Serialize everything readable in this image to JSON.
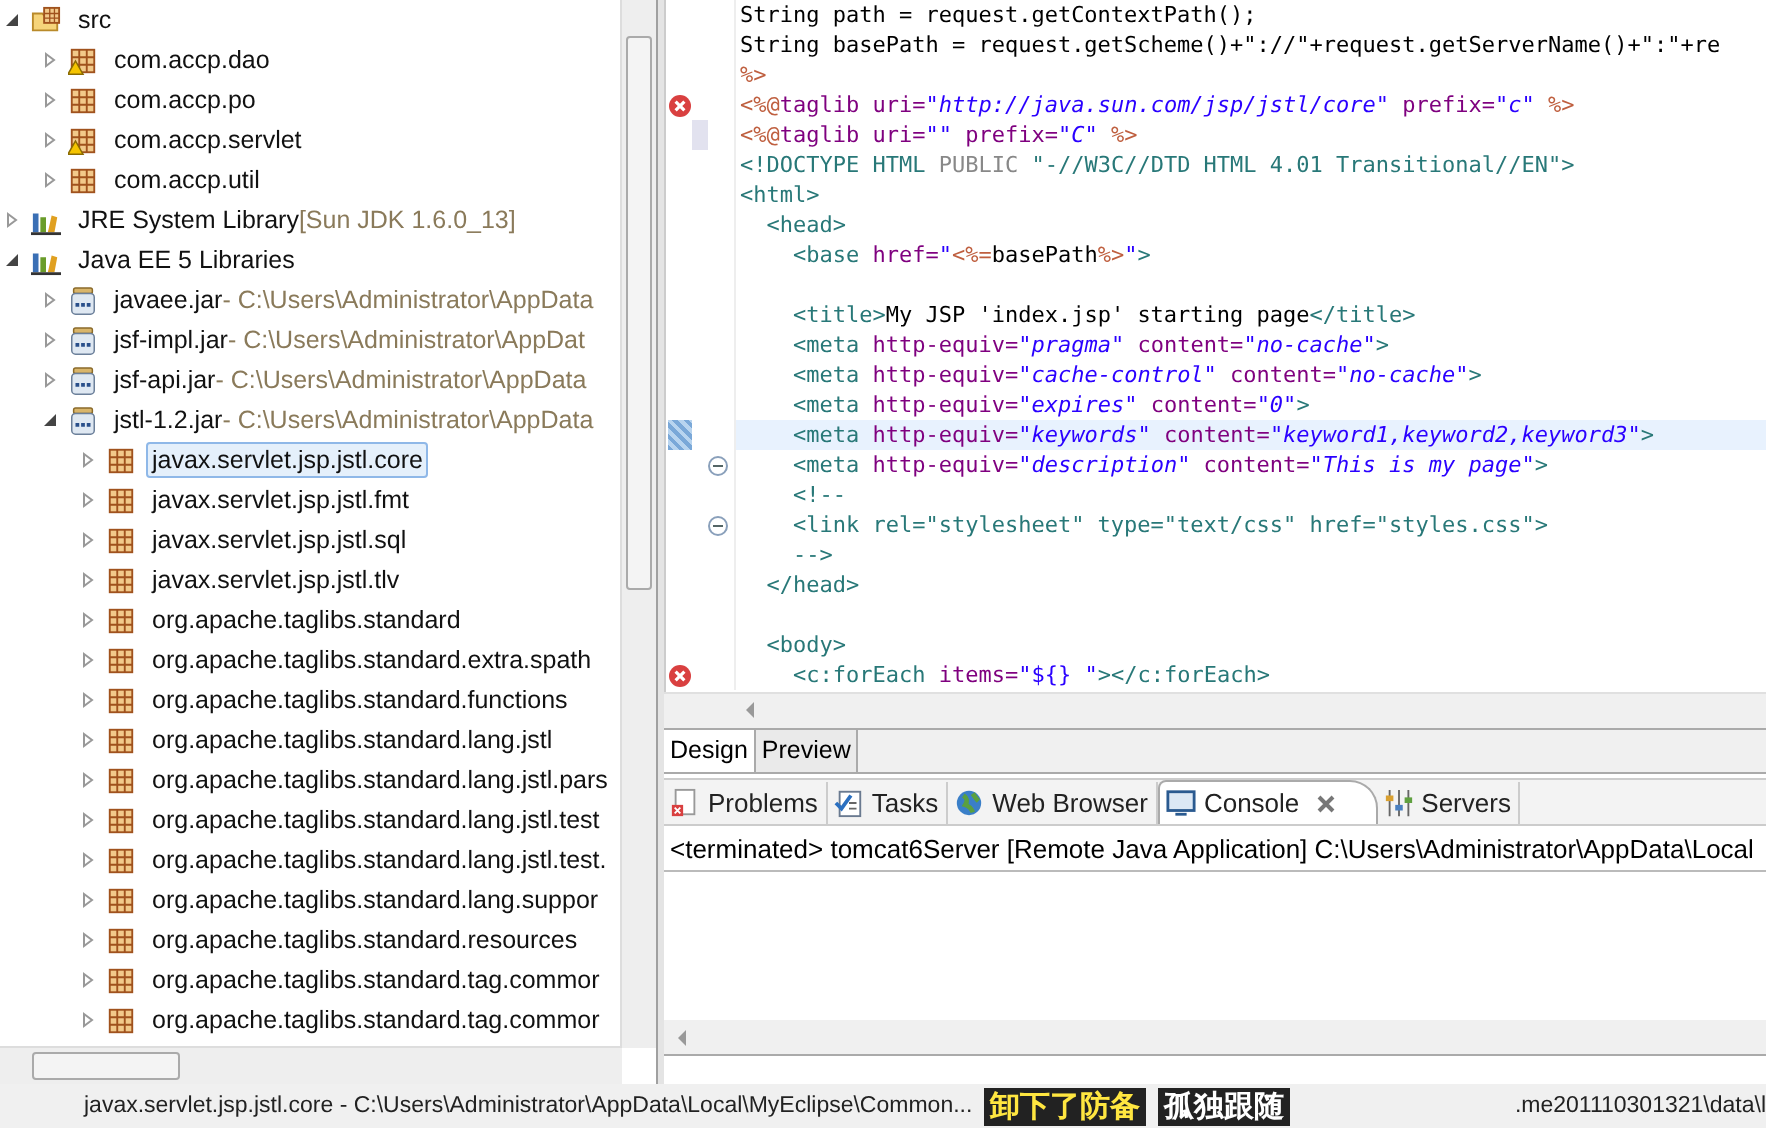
{
  "tree": [
    {
      "label": "src",
      "kind": "source-folder",
      "expanded": true,
      "selected": false,
      "children": [
        {
          "label": "com.accp.dao",
          "kind": "package-warning",
          "expanded": false,
          "selected": false
        },
        {
          "label": "com.accp.po",
          "kind": "package",
          "expanded": false,
          "selected": false
        },
        {
          "label": "com.accp.servlet",
          "kind": "package-warning",
          "expanded": false,
          "selected": false
        },
        {
          "label": "com.accp.util",
          "kind": "package",
          "expanded": false,
          "selected": false
        }
      ]
    },
    {
      "label": "JRE System Library",
      "detail": "[Sun JDK 1.6.0_13]",
      "kind": "library",
      "expanded": false,
      "selected": false
    },
    {
      "label": "Java EE 5 Libraries",
      "kind": "library",
      "expanded": true,
      "selected": false,
      "children": [
        {
          "label": "javaee.jar",
          "detail": "- C:\\Users\\Administrator\\AppData",
          "kind": "jar",
          "expanded": false,
          "selected": false
        },
        {
          "label": "jsf-impl.jar",
          "detail": "- C:\\Users\\Administrator\\AppDat",
          "kind": "jar",
          "expanded": false,
          "selected": false
        },
        {
          "label": "jsf-api.jar",
          "detail": "- C:\\Users\\Administrator\\AppData",
          "kind": "jar",
          "expanded": false,
          "selected": false
        },
        {
          "label": "jstl-1.2.jar",
          "detail": "- C:\\Users\\Administrator\\AppData",
          "kind": "jar",
          "expanded": true,
          "selected": false,
          "children": [
            {
              "label": "javax.servlet.jsp.jstl.core",
              "kind": "package",
              "expanded": false,
              "selected": true
            },
            {
              "label": "javax.servlet.jsp.jstl.fmt",
              "kind": "package",
              "expanded": false,
              "selected": false
            },
            {
              "label": "javax.servlet.jsp.jstl.sql",
              "kind": "package",
              "expanded": false,
              "selected": false
            },
            {
              "label": "javax.servlet.jsp.jstl.tlv",
              "kind": "package",
              "expanded": false,
              "selected": false
            },
            {
              "label": "org.apache.taglibs.standard",
              "kind": "package",
              "expanded": false,
              "selected": false
            },
            {
              "label": "org.apache.taglibs.standard.extra.spath",
              "kind": "package",
              "expanded": false,
              "selected": false
            },
            {
              "label": "org.apache.taglibs.standard.functions",
              "kind": "package",
              "expanded": false,
              "selected": false
            },
            {
              "label": "org.apache.taglibs.standard.lang.jstl",
              "kind": "package",
              "expanded": false,
              "selected": false
            },
            {
              "label": "org.apache.taglibs.standard.lang.jstl.pars",
              "kind": "package",
              "expanded": false,
              "selected": false
            },
            {
              "label": "org.apache.taglibs.standard.lang.jstl.test",
              "kind": "package",
              "expanded": false,
              "selected": false
            },
            {
              "label": "org.apache.taglibs.standard.lang.jstl.test.",
              "kind": "package",
              "expanded": false,
              "selected": false
            },
            {
              "label": "org.apache.taglibs.standard.lang.suppor",
              "kind": "package",
              "expanded": false,
              "selected": false
            },
            {
              "label": "org.apache.taglibs.standard.resources",
              "kind": "package",
              "expanded": false,
              "selected": false
            },
            {
              "label": "org.apache.taglibs.standard.tag.commor",
              "kind": "package",
              "expanded": false,
              "selected": false
            },
            {
              "label": "org.apache.taglibs.standard.tag.commor",
              "kind": "package",
              "expanded": false,
              "selected": false
            }
          ]
        }
      ]
    }
  ],
  "editor": {
    "lines": [
      {
        "kind": "plain",
        "current": false,
        "segments": [
          {
            "kind": "plain",
            "text": "String path = request.getContextPath();"
          }
        ]
      },
      {
        "kind": "plain",
        "current": false,
        "segments": [
          {
            "kind": "plain",
            "text": "String basePath = request.getScheme()+\"://\"+request.getServerName()+\":\"+re"
          }
        ]
      },
      {
        "kind": "plain",
        "current": false,
        "segments": [
          {
            "kind": "jsp",
            "text": "%>"
          }
        ]
      },
      {
        "kind": "error",
        "current": false,
        "segments": [
          {
            "kind": "jsp",
            "text": "<%@"
          },
          {
            "kind": "attr",
            "text": "taglib uri="
          },
          {
            "kind": "value",
            "text": "\"http://java.sun.com/jsp/jstl/core\""
          },
          {
            "kind": "attr",
            "text": " prefix="
          },
          {
            "kind": "value",
            "text": "\"c\""
          },
          {
            "kind": "jsp",
            "text": " %>"
          }
        ]
      },
      {
        "kind": "change",
        "current": false,
        "segments": [
          {
            "kind": "jsp",
            "text": "<%@"
          },
          {
            "kind": "attr",
            "text": "taglib uri="
          },
          {
            "kind": "value",
            "text": "\"\""
          },
          {
            "kind": "attr",
            "text": " prefix="
          },
          {
            "kind": "value",
            "text": "\"C\""
          },
          {
            "kind": "jsp",
            "text": " %>"
          }
        ]
      },
      {
        "kind": "plain",
        "current": false,
        "segments": [
          {
            "kind": "tag",
            "text": "<!DOCTYPE HTML "
          },
          {
            "kind": "grey",
            "text": "PUBLIC"
          },
          {
            "kind": "tag",
            "text": " \"-//W3C//DTD HTML 4.01 Transitional//EN\">"
          }
        ]
      },
      {
        "kind": "plain",
        "current": false,
        "segments": [
          {
            "kind": "tag",
            "text": "<html>"
          }
        ]
      },
      {
        "kind": "plain",
        "current": false,
        "segments": [
          {
            "kind": "tag",
            "text": "  <head>"
          }
        ]
      },
      {
        "kind": "plain",
        "current": false,
        "segments": [
          {
            "kind": "tag",
            "text": "    <base "
          },
          {
            "kind": "attr",
            "text": "href="
          },
          {
            "kind": "string",
            "text": "\""
          },
          {
            "kind": "jsp",
            "text": "<%="
          },
          {
            "kind": "plain",
            "text": "basePath"
          },
          {
            "kind": "jsp",
            "text": "%>"
          },
          {
            "kind": "string",
            "text": "\""
          },
          {
            "kind": "tag",
            "text": ">"
          }
        ]
      },
      {
        "kind": "plain",
        "current": false
      },
      {
        "kind": "plain",
        "current": false,
        "segments": [
          {
            "kind": "tag",
            "text": "    <title>"
          },
          {
            "kind": "plain",
            "text": "My JSP 'index.jsp' starting page"
          },
          {
            "kind": "tag",
            "text": "</title>"
          }
        ]
      },
      {
        "kind": "plain",
        "current": false,
        "segments": [
          {
            "kind": "tag",
            "text": "    <meta "
          },
          {
            "kind": "attr",
            "text": "http-equiv="
          },
          {
            "kind": "value",
            "text": "\"pragma\""
          },
          {
            "kind": "attr",
            "text": " content="
          },
          {
            "kind": "value",
            "text": "\"no-cache\""
          },
          {
            "kind": "tag",
            "text": ">"
          }
        ]
      },
      {
        "kind": "plain",
        "current": false,
        "segments": [
          {
            "kind": "tag",
            "text": "    <meta "
          },
          {
            "kind": "attr",
            "text": "http-equiv="
          },
          {
            "kind": "value",
            "text": "\"cache-control\""
          },
          {
            "kind": "attr",
            "text": " content="
          },
          {
            "kind": "value",
            "text": "\"no-cache\""
          },
          {
            "kind": "tag",
            "text": ">"
          }
        ]
      },
      {
        "kind": "plain",
        "current": false,
        "segments": [
          {
            "kind": "tag",
            "text": "    <meta "
          },
          {
            "kind": "attr",
            "text": "http-equiv="
          },
          {
            "kind": "value",
            "text": "\"expires\""
          },
          {
            "kind": "attr",
            "text": " content="
          },
          {
            "kind": "value",
            "text": "\"0\""
          },
          {
            "kind": "tag",
            "text": ">"
          }
        ]
      },
      {
        "kind": "occurrence",
        "current": true,
        "segments": [
          {
            "kind": "tag",
            "text": "    <meta "
          },
          {
            "kind": "attr",
            "text": "http-equiv="
          },
          {
            "kind": "value",
            "text": "\"keywords\""
          },
          {
            "kind": "attr",
            "text": " content="
          },
          {
            "kind": "value",
            "text": "\"keyword1,keyword2,keyword3\""
          },
          {
            "kind": "tag",
            "text": ">"
          }
        ]
      },
      {
        "kind": "fold",
        "current": false,
        "segments": [
          {
            "kind": "tag",
            "text": "    <meta "
          },
          {
            "kind": "attr",
            "text": "http-equiv="
          },
          {
            "kind": "value",
            "text": "\"description\""
          },
          {
            "kind": "attr",
            "text": " content="
          },
          {
            "kind": "value",
            "text": "\"This is my page\""
          },
          {
            "kind": "tag",
            "text": ">"
          }
        ]
      },
      {
        "kind": "plain",
        "current": false,
        "segments": [
          {
            "kind": "tag",
            "text": "    <!--"
          }
        ]
      },
      {
        "kind": "fold",
        "current": false,
        "segments": [
          {
            "kind": "tag",
            "text": "    <link rel=\"stylesheet\" type=\"text/css\" href=\"styles.css\">"
          }
        ]
      },
      {
        "kind": "plain",
        "current": false,
        "segments": [
          {
            "kind": "tag",
            "text": "    -->"
          }
        ]
      },
      {
        "kind": "plain",
        "current": false,
        "segments": [
          {
            "kind": "tag",
            "text": "  </head>"
          }
        ]
      },
      {
        "kind": "plain",
        "current": false
      },
      {
        "kind": "plain",
        "current": false,
        "segments": [
          {
            "kind": "tag",
            "text": "  <body>"
          }
        ]
      },
      {
        "kind": "error",
        "current": false,
        "segments": [
          {
            "kind": "tag",
            "text": "    <c:forEach "
          },
          {
            "kind": "attr",
            "text": "items="
          },
          {
            "kind": "string",
            "text": "\"${} \""
          },
          {
            "kind": "tag",
            "text": "></c:forEach>"
          }
        ]
      }
    ],
    "tabs": [
      {
        "label": "Design",
        "selected": true
      },
      {
        "label": "Preview",
        "selected": false
      }
    ]
  },
  "panel": {
    "tabs": [
      {
        "label": "Problems",
        "kind": "problems",
        "selected": false,
        "closable": false
      },
      {
        "label": "Tasks",
        "kind": "tasks",
        "selected": false,
        "closable": false
      },
      {
        "label": "Web Browser",
        "kind": "globe",
        "selected": false,
        "closable": false
      },
      {
        "label": "Console",
        "kind": "console",
        "selected": true,
        "closable": true
      },
      {
        "label": "Servers",
        "kind": "servers",
        "selected": false,
        "closable": false
      }
    ],
    "console_header": "<terminated> tomcat6Server [Remote Java Application] C:\\Users\\Administrator\\AppData\\Local"
  },
  "status_bar": {
    "text": "javax.servlet.jsp.jstl.core - C:\\Users\\Administrator\\AppData\\Local\\MyEclipse\\Common...",
    "subtitle_1": "卸下了防备",
    "subtitle_2": "孤独跟随",
    "text_end": ".me201110301321\\data\\l"
  }
}
